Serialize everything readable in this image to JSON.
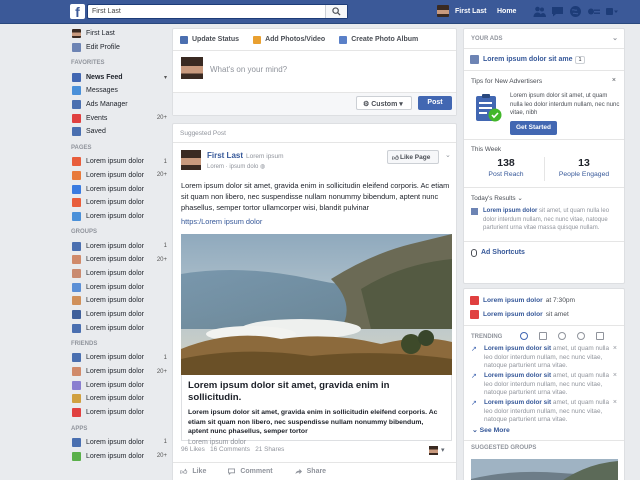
{
  "topbar": {
    "logo": "f",
    "search_placeholder": "First Last",
    "user_name": "First Last",
    "home": "Home",
    "icons": [
      "friend-requests-icon",
      "messages-icon",
      "notifications-icon",
      "privacy-shortcuts-icon",
      "settings-icon"
    ]
  },
  "left_nav": {
    "profile": [
      {
        "label": "First Last",
        "icon": "avatar"
      },
      {
        "label": "Edit Profile",
        "icon": "pencil-icon"
      }
    ],
    "favorites_title": "FAVORITES",
    "favorites": [
      {
        "label": "News Feed",
        "icon": "news-feed-icon",
        "count": "",
        "color": "#4267b2",
        "bold": true
      },
      {
        "label": "Messages",
        "icon": "messages-icon",
        "count": "",
        "color": "#4a90d9"
      },
      {
        "label": "Ads Manager",
        "icon": "ads-manager-icon",
        "count": "",
        "color": "#4a6fb0"
      },
      {
        "label": "Events",
        "icon": "calendar-icon",
        "count": "20+",
        "color": "#e04040"
      },
      {
        "label": "Saved",
        "icon": "bookmark-icon",
        "count": "",
        "color": "#4a6fb0"
      }
    ],
    "pages_title": "PAGES",
    "pages": [
      {
        "label": "Lorem ipsum dolor",
        "count": "1",
        "color": "#e85d3b"
      },
      {
        "label": "Lorem ipsum dolor",
        "count": "20+",
        "color": "#e87a3b"
      },
      {
        "label": "Lorem ipsum dolor",
        "count": "",
        "color": "#3a7be0"
      },
      {
        "label": "Lorem ipsum dolor",
        "count": "",
        "color": "#e85d3b"
      },
      {
        "label": "Lorem ipsum dolor",
        "count": "",
        "color": "#4a90d9"
      }
    ],
    "groups_title": "GROUPS",
    "groups": [
      {
        "label": "Lorem ipsum dolor",
        "count": "1",
        "color": "#4a6fb0"
      },
      {
        "label": "Lorem ipsum dolor",
        "count": "20+",
        "color": "#d08a6a"
      },
      {
        "label": "Lorem ipsum dolor",
        "count": "",
        "color": "#c98a70"
      },
      {
        "label": "Lorem ipsum dolor",
        "count": "",
        "color": "#5b8fd6"
      },
      {
        "label": "Lorem ipsum dolor",
        "count": "",
        "color": "#d0905a"
      },
      {
        "label": "Lorem ipsum dolor",
        "count": "",
        "color": "#3f5f9a"
      },
      {
        "label": "Lorem ipsum dolor",
        "count": "",
        "color": "#4a6fb0"
      }
    ],
    "friends_title": "FRIENDS",
    "friends": [
      {
        "label": "Lorem ipsum dolor",
        "count": "1",
        "color": "#4a6fb0"
      },
      {
        "label": "Lorem ipsum dolor",
        "count": "20+",
        "color": "#d08a6a"
      },
      {
        "label": "Lorem ipsum dolor",
        "count": "",
        "color": "#8a7fd0"
      },
      {
        "label": "Lorem ipsum dolor",
        "count": "",
        "color": "#d0a040"
      },
      {
        "label": "Lorem ipsum dolor",
        "count": "",
        "color": "#e04040"
      }
    ],
    "apps_title": "APPS",
    "apps": [
      {
        "label": "Lorem ipsum dolor",
        "count": "1",
        "color": "#4a6fb0"
      },
      {
        "label": "Lorem ipsum dolor",
        "count": "20+",
        "color": "#5ab04a"
      }
    ]
  },
  "composer": {
    "tabs": [
      {
        "label": "Update Status",
        "icon": "pencil-icon"
      },
      {
        "label": "Add Photos/Video",
        "icon": "photo-icon"
      },
      {
        "label": "Create Photo Album",
        "icon": "album-icon"
      }
    ],
    "placeholder": "What's on your mind?",
    "audience": "Custom",
    "post": "Post"
  },
  "post": {
    "label": "Suggested Post",
    "author": "First Last",
    "author_suffix": "Lorem ipsum",
    "subline": "Lorem · ipsum dolo",
    "like_page": "Like Page",
    "text": "Lorem ipsum dolor sit amet, gravida enim in sollicitudin eleifend corporis. Ac etiam sit quam non libero, nec suspendisse nullam nonummy bibendum, aptent nunc phasellus, semper tortor ullamcorper wisi, blandit pulvinar",
    "link": "https:/Lorem ipsum dolor",
    "link_title": "Lorem ipsum dolor sit amet, gravida enim in sollicitudin.",
    "link_desc": "Lorem ipsum dolor sit amet, gravida enim in sollicitudin eleifend corporis. Ac etiam sit quam non libero, nec suspendisse nullam nonummy bibendum, aptent nunc phasellus, semper tortor",
    "link_domain": "Lorem ipsum dolor",
    "stats": "96 Likes   16 Comments   21 Shares",
    "actions": [
      "Like",
      "Comment",
      "Share"
    ]
  },
  "ads": {
    "title": "YOUR ADS",
    "ad_name": "Lorem ipsum dolor sit ame",
    "ad_badge": "1",
    "tips_title": "Tips for New Advertisers",
    "tips_desc": "Lorem ipsum dolor sit amet, ut quam nulla leo dolor interdum nullam, nec nunc vitae, nibh",
    "get_started": "Get Started",
    "week_title": "This Week",
    "post_reach_value": "138",
    "post_reach_label": "Post Reach",
    "engaged_value": "13",
    "engaged_label": "People Engaged",
    "today_title": "Today's Results",
    "today_link": "Lorem ipsum dolor",
    "today_text": " sit amet, ut quam nulla leo dolor interdum nullam, nec nunc vitae, natoque parturient urna vitae massa quisque nullam.",
    "shortcuts": "Ad Shortcuts"
  },
  "side": {
    "events": [
      {
        "link": "Lorem ipsum dolor",
        "text": "at 7:30pm",
        "color": "#e04040"
      },
      {
        "link": "Lorem ipsum dolor",
        "text": "sit amet",
        "color": "#e04040"
      }
    ],
    "trending_title": "TRENDING",
    "trends": [
      {
        "link": "Lorem ipsum dolor sit",
        "text": " amet, ut quam nulla leo dolor interdum nullam, nec nunc vitae, natoque parturient urna vitae."
      },
      {
        "link": "Lorem ipsum dolor sit",
        "text": " amet, ut quam nulla leo dolor interdum nullam, nec nunc vitae, natoque parturient urna vitae."
      },
      {
        "link": "Lorem ipsum dolor sit",
        "text": " amet, ut quam nulla leo dolor interdum nullam, nec nunc vitae, natoque parturient urna vitae."
      }
    ],
    "see_more": "See More",
    "suggested_groups": "SUGGESTED GROUPS"
  }
}
